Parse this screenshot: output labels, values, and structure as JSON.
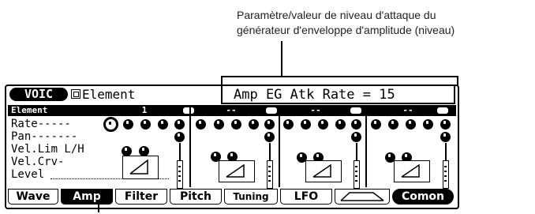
{
  "annotation": {
    "line1": "Paramètre/valeur de niveau d'attaque du",
    "line2": "générateur d'enveloppe d'amplitude (niveau)"
  },
  "lcd": {
    "mode_label": "VOIC",
    "screen_title": "Element",
    "parameter_display": "Amp EG Atk Rate = 15",
    "element_row_label": "Element",
    "element_numbers": [
      "1",
      "--",
      "--",
      "--"
    ],
    "row_labels": [
      "Rate-----",
      "Pan-------",
      "Vel.Lim L/H",
      "Vel.Crv-",
      "Level"
    ],
    "tabs": [
      "Wave",
      "Amp",
      "Filter",
      "Pitch",
      "Tuning",
      "LFO",
      "",
      "Comon"
    ],
    "active_tab": "Amp"
  }
}
